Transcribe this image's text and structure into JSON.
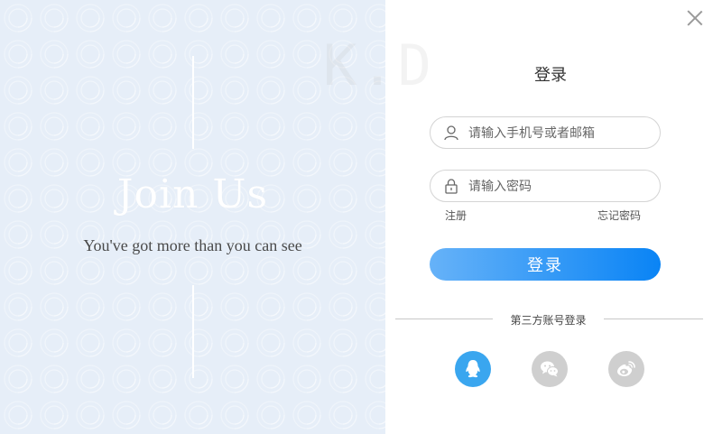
{
  "brand": {
    "title": "Join Us",
    "subtitle": "You've got more than you can see",
    "watermark": "K.D"
  },
  "login": {
    "title": "登录",
    "username_placeholder": "请输入手机号或者邮箱",
    "password_placeholder": "请输入密码",
    "register_label": "注册",
    "forgot_label": "忘记密码",
    "submit_label": "登录",
    "third_party_label": "第三方账号登录"
  },
  "social": [
    {
      "name": "qq-icon"
    },
    {
      "name": "wechat-icon"
    },
    {
      "name": "weibo-icon"
    }
  ],
  "colors": {
    "accent": "#0a84f5",
    "accent_light": "#66b2f8",
    "qq": "#3aa6ef",
    "inactive_social": "#cfcfcf",
    "left_bg": "#e6eef8"
  }
}
